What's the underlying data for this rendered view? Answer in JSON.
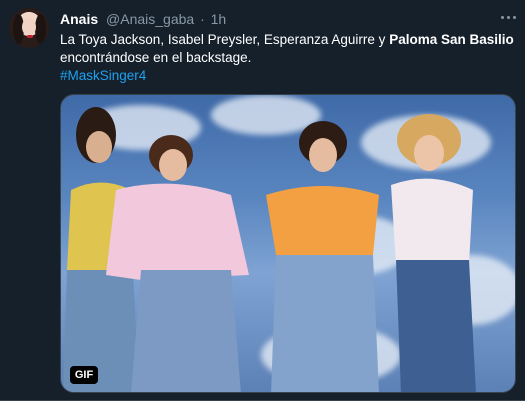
{
  "tweet": {
    "author_name": "Anais",
    "author_handle": "@Anais_gaba",
    "separator": "·",
    "timestamp": "1h",
    "text_plain": "La Toya Jackson, Isabel Preysler, Esperanza Aguirre y ",
    "text_bold": "Paloma San Basilio",
    "text_after": " encontrándose en el backstage.",
    "hashtag": "#MaskSinger4",
    "media_badge": "GIF"
  },
  "icons": {
    "more": "more-horizontal-icon"
  },
  "colors": {
    "background": "#15202b",
    "secondary_text": "#8899a6",
    "link": "#1da1f2",
    "border": "#38444d"
  }
}
